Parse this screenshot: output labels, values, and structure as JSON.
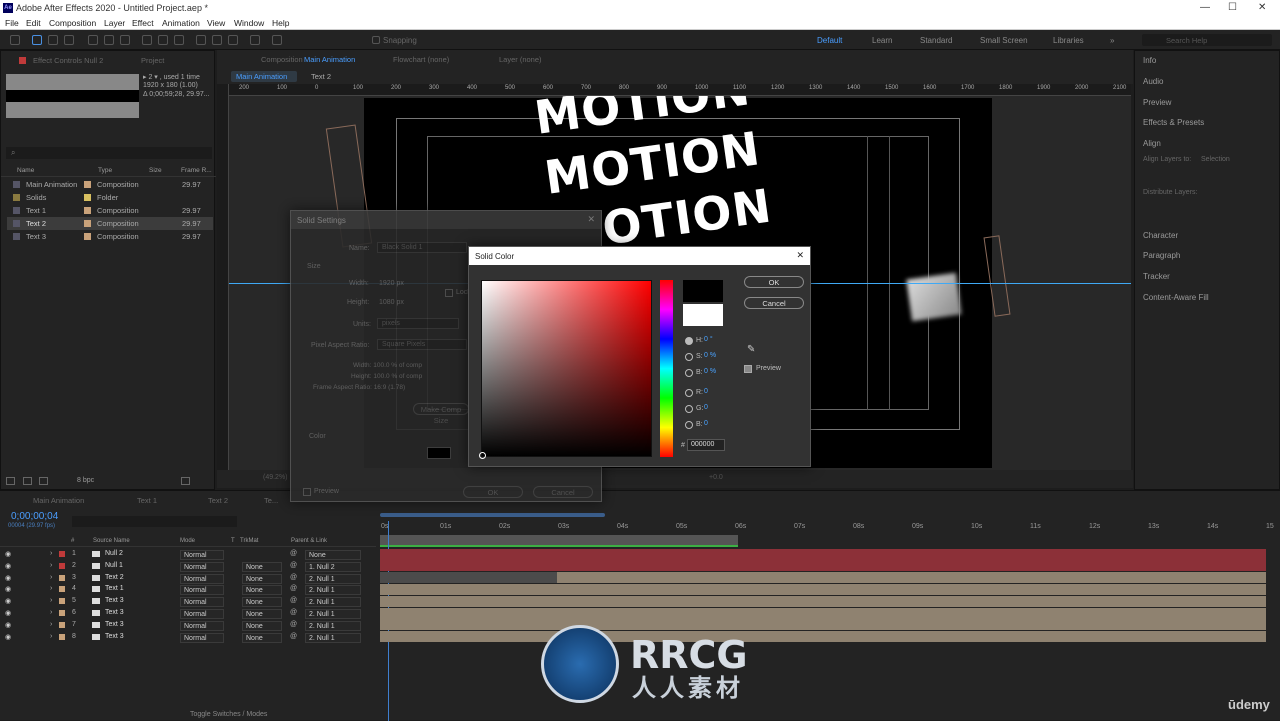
{
  "window": {
    "title": "Adobe After Effects 2020 - Untitled Project.aep *",
    "app_badge": "Ae",
    "minimize": "—",
    "maximize": "☐",
    "close": "✕"
  },
  "menu": [
    "File",
    "Edit",
    "Composition",
    "Layer",
    "Effect",
    "Animation",
    "View",
    "Window",
    "Help"
  ],
  "toolbar": {
    "snapping": "Snapping",
    "workspaces": [
      "Default",
      "Learn",
      "Standard",
      "Small Screen",
      "Libraries"
    ],
    "more": "»",
    "search_placeholder": "Search Help"
  },
  "project": {
    "tab_effect": "Effect Controls Null 2",
    "tab_project": "Project",
    "info_line1": "▸ 2 ▾ , used 1 time",
    "info_line2": "1920 x 180 (1.00)",
    "info_line3": "Δ 0;00;59;28, 29.97...",
    "search_glyph": "⌕",
    "columns": [
      "Name",
      "Type",
      "Size",
      "Frame R..."
    ],
    "items": [
      {
        "name": "Main Animation",
        "type": "Composition",
        "rate": "29.97",
        "color": "#c9a27a"
      },
      {
        "name": "Solids",
        "type": "Folder",
        "rate": "",
        "color": "#d8c060"
      },
      {
        "name": "Text 1",
        "type": "Composition",
        "rate": "29.97",
        "color": "#c9a27a"
      },
      {
        "name": "Text 2",
        "type": "Composition",
        "rate": "29.97",
        "color": "#c9a27a"
      },
      {
        "name": "Text 3",
        "type": "Composition",
        "rate": "29.97",
        "color": "#c9a27a"
      }
    ],
    "bpc": "8 bpc"
  },
  "viewer": {
    "tab_comp": "Composition",
    "tab_comp_name": "Main Animation",
    "tab_flowchart": "Flowchart (none)",
    "tab_layer": "Layer (none)",
    "crumb1": "Main Animation",
    "crumb2": "Text 2",
    "motion_text": "MOTION",
    "motion_text2": "MOTION",
    "motion_text3": "OTION",
    "ruler": [
      "200",
      "100",
      "0",
      "100",
      "200",
      "300",
      "400",
      "500",
      "600",
      "700",
      "800",
      "900",
      "1000",
      "1100",
      "1200",
      "1300",
      "1400",
      "1500",
      "1600",
      "1700",
      "1800",
      "1900",
      "2000",
      "2100"
    ],
    "bottom_zoom": "(49.2%)",
    "bottom_exposure": "+0.0"
  },
  "right_panels": [
    "Info",
    "Audio",
    "Preview",
    "Effects & Presets",
    "Align",
    "Align Layers to:",
    "Distribute Layers:",
    "Character",
    "Paragraph",
    "Tracker",
    "Content-Aware Fill"
  ],
  "align_selection": "Selection",
  "solid_settings": {
    "title": "Solid Settings",
    "name_label": "Name:",
    "name_value": "Black Solid 1",
    "size_label": "Size",
    "width_label": "Width:",
    "width_value": "1920 px",
    "height_label": "Height:",
    "height_value": "1080 px",
    "lock_label": "Lock Aspect Ratio",
    "units_label": "Units:",
    "units_value": "pixels",
    "par_label": "Pixel Aspect Ratio:",
    "par_value": "Square Pixels",
    "w_pct": "Width: 100.0 % of comp",
    "h_pct": "Height: 100.0 % of comp",
    "far": "Frame Aspect Ratio: 16:9 (1.78)",
    "make_comp": "Make Comp Size",
    "color_label": "Color",
    "preview": "Preview",
    "ok": "OK",
    "cancel": "Cancel"
  },
  "solid_color": {
    "title": "Solid Color",
    "ok": "OK",
    "cancel": "Cancel",
    "preview": "Preview",
    "h_label": "H:",
    "h_value": "0 °",
    "s_label": "S:",
    "s_value": "0 %",
    "b_label": "B:",
    "b_value": "0 %",
    "r_label": "R:",
    "r_value": "0",
    "g_label": "G:",
    "g_value": "0",
    "b2_label": "B:",
    "b2_value": "0",
    "hex_label": "#",
    "hex_value": "000000",
    "new_color": "#000000",
    "old_color": "#ffffff"
  },
  "timeline": {
    "tabs": [
      "Main Animation",
      "Text 1",
      "Text 2",
      "Te..."
    ],
    "timecode": "0;00;00;04",
    "fps": "00004 (29.97 fps)",
    "cols": [
      "#",
      "Source Name",
      "Mode",
      "T",
      "TrkMat",
      "Parent & Link"
    ],
    "ticks": [
      "0s",
      "01s",
      "02s",
      "03s",
      "04s",
      "05s",
      "06s",
      "07s",
      "08s",
      "09s",
      "10s",
      "11s",
      "12s",
      "13s",
      "14s",
      "15"
    ],
    "layers": [
      {
        "num": "1",
        "name": "Null 2",
        "mode": "Normal",
        "trk": "",
        "parent": "None",
        "color": "#c03a3a",
        "bar": "#8c3038"
      },
      {
        "num": "2",
        "name": "Null 1",
        "mode": "Normal",
        "trk": "None",
        "parent": "1. Null 2",
        "color": "#c03a3a",
        "bar": "#8c3038"
      },
      {
        "num": "3",
        "name": "Text 2",
        "mode": "Normal",
        "trk": "None",
        "parent": "2. Null 1",
        "color": "#c9a27a",
        "bar": "#8f8270"
      },
      {
        "num": "4",
        "name": "Text 1",
        "mode": "Normal",
        "trk": "None",
        "parent": "2. Null 1",
        "color": "#c9a27a",
        "bar": "#8f8270"
      },
      {
        "num": "5",
        "name": "Text 3",
        "mode": "Normal",
        "trk": "None",
        "parent": "2. Null 1",
        "color": "#c9a27a",
        "bar": "#8f8270"
      },
      {
        "num": "6",
        "name": "Text 3",
        "mode": "Normal",
        "trk": "None",
        "parent": "2. Null 1",
        "color": "#c9a27a",
        "bar": "#8f8270"
      },
      {
        "num": "7",
        "name": "Text 3",
        "mode": "Normal",
        "trk": "None",
        "parent": "2. Null 1",
        "color": "#c9a27a",
        "bar": "#8f8270"
      },
      {
        "num": "8",
        "name": "Text 3",
        "mode": "Normal",
        "trk": "None",
        "parent": "2. Null 1",
        "color": "#c9a27a",
        "bar": "#8f8270"
      }
    ],
    "toggle": "Toggle Switches / Modes"
  },
  "watermark": {
    "brand": "RRCG",
    "sub": "人人素材",
    "udemy": "ūdemy"
  }
}
